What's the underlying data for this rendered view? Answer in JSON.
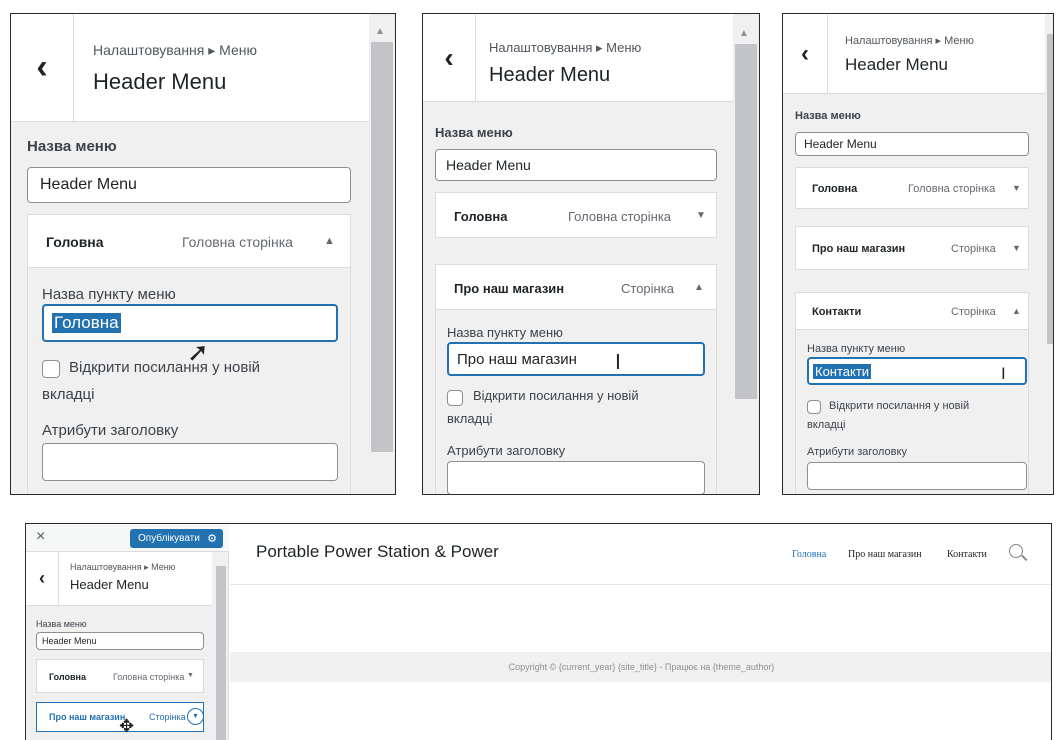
{
  "breadcrumb": "Налаштовування ▸ Меню",
  "section_title": "Header Menu",
  "menu_name_label": "Назва меню",
  "menu_name_value": "Header Menu",
  "item_name_label": "Назва пункту меню",
  "open_new_tab_label_1": "Відкрити посилання у новій",
  "open_new_tab_label_2": "вкладці",
  "title_attr_label": "Атрибути заголовку",
  "items": {
    "home": {
      "title": "Головна",
      "type": "Головна сторінка"
    },
    "about": {
      "title": "Про наш магазин",
      "type": "Сторінка"
    },
    "contacts": {
      "title": "Контакти",
      "type": "Сторінка"
    }
  },
  "publish_label": "Опублікувати",
  "site_title": "Portable Power Station & Power",
  "nav": [
    "Головна",
    "Про наш магазин",
    "Контакти"
  ],
  "footer_text": "Copyright © {current_year} {site_title} - Працює на {theme_author}",
  "icons": {
    "back": "‹",
    "close": "×",
    "gear": "⚙",
    "search": "○",
    "up": "▲",
    "down": "▼"
  },
  "colors": {
    "accent": "#2271b1",
    "panel_bg": "#f0f0f1"
  }
}
